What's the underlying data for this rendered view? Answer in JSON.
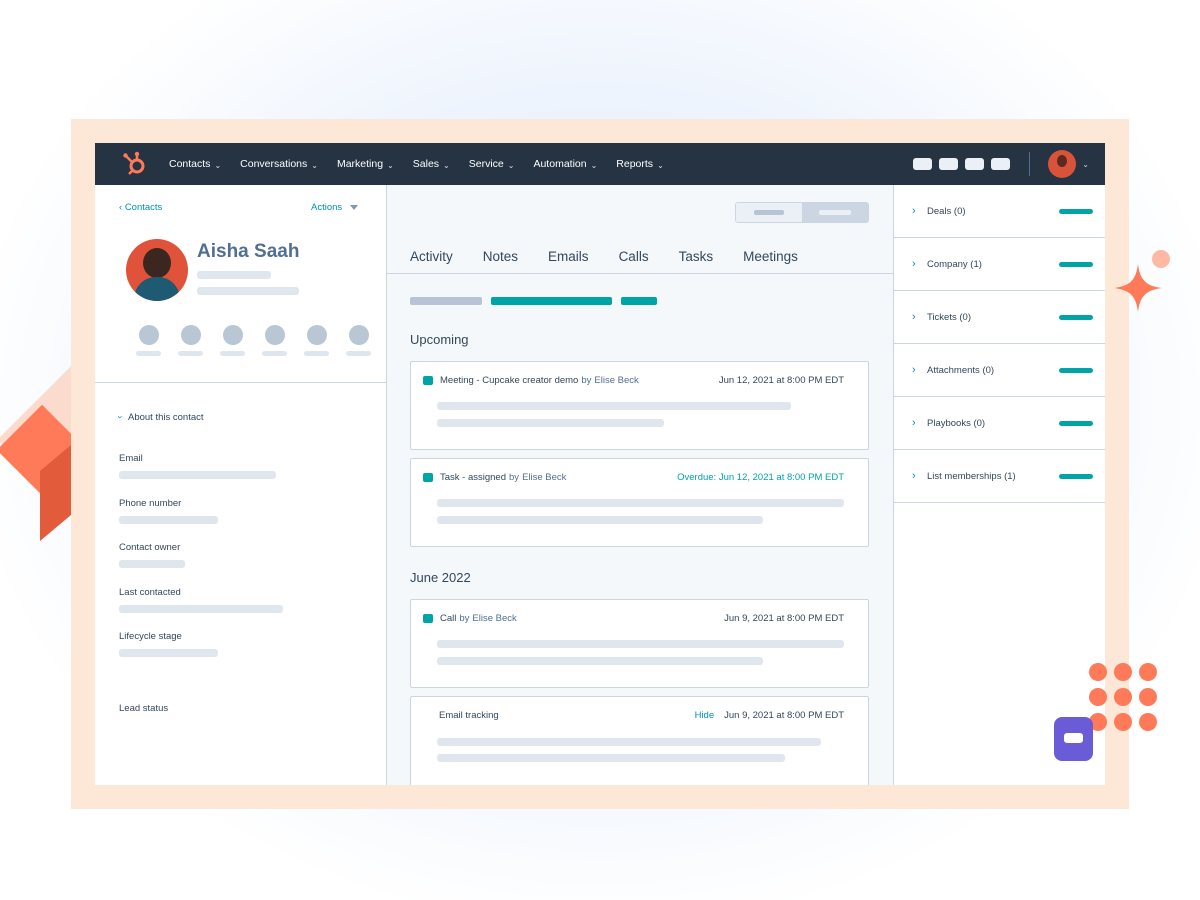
{
  "nav": {
    "items": [
      {
        "label": "Contacts"
      },
      {
        "label": "Conversations"
      },
      {
        "label": "Marketing"
      },
      {
        "label": "Sales"
      },
      {
        "label": "Service"
      },
      {
        "label": "Automation"
      },
      {
        "label": "Reports"
      }
    ],
    "chevron": "⌄"
  },
  "left": {
    "back_label": "Contacts",
    "actions_label": "Actions",
    "contact_name": "Aisha Saah",
    "about_label": "About this contact",
    "properties": [
      "Email",
      "Phone number",
      "Contact owner",
      "Last contacted",
      "Lifecycle stage",
      "Lead status"
    ]
  },
  "mid": {
    "tabs": [
      "Activity",
      "Notes",
      "Emails",
      "Calls",
      "Tasks",
      "Meetings"
    ],
    "sections": {
      "upcoming": "Upcoming",
      "june": "June 2022"
    },
    "cards": [
      {
        "title": "Meeting - Cupcake creator demo",
        "by": "by",
        "who": "Elise Beck",
        "date": "Jun 12, 2021 at 8:00 PM EDT"
      },
      {
        "title": "Task - assigned",
        "by": "by",
        "who": "Elise Beck",
        "date": "Overdue: Jun 12, 2021 at 8:00 PM EDT"
      },
      {
        "title": "Call",
        "by": "by",
        "who": "Elise Beck",
        "date": "Jun 9, 2021 at 8:00 PM EDT"
      },
      {
        "title": "Email tracking",
        "hide": "Hide",
        "date": "Jun 9, 2021 at 8:00 PM EDT"
      }
    ]
  },
  "right": {
    "rows": [
      "Deals (0)",
      "Company (1)",
      "Tickets (0)",
      "Attachments (0)",
      "Playbooks (0)",
      "List memberships (1)"
    ]
  },
  "colors": {
    "nav_bg": "#253342",
    "accent_teal": "#00a4a6",
    "link_blue": "#0091ae",
    "brand_orange": "#ff7a59",
    "frame": "#fde8d7",
    "chat": "#6a5bd6"
  },
  "icons": [
    "hubspot-logo-icon",
    "chevron-left-icon",
    "chevron-down-icon",
    "chevron-right-icon",
    "caret-down-icon",
    "chat-icon",
    "sparkle-icon"
  ]
}
